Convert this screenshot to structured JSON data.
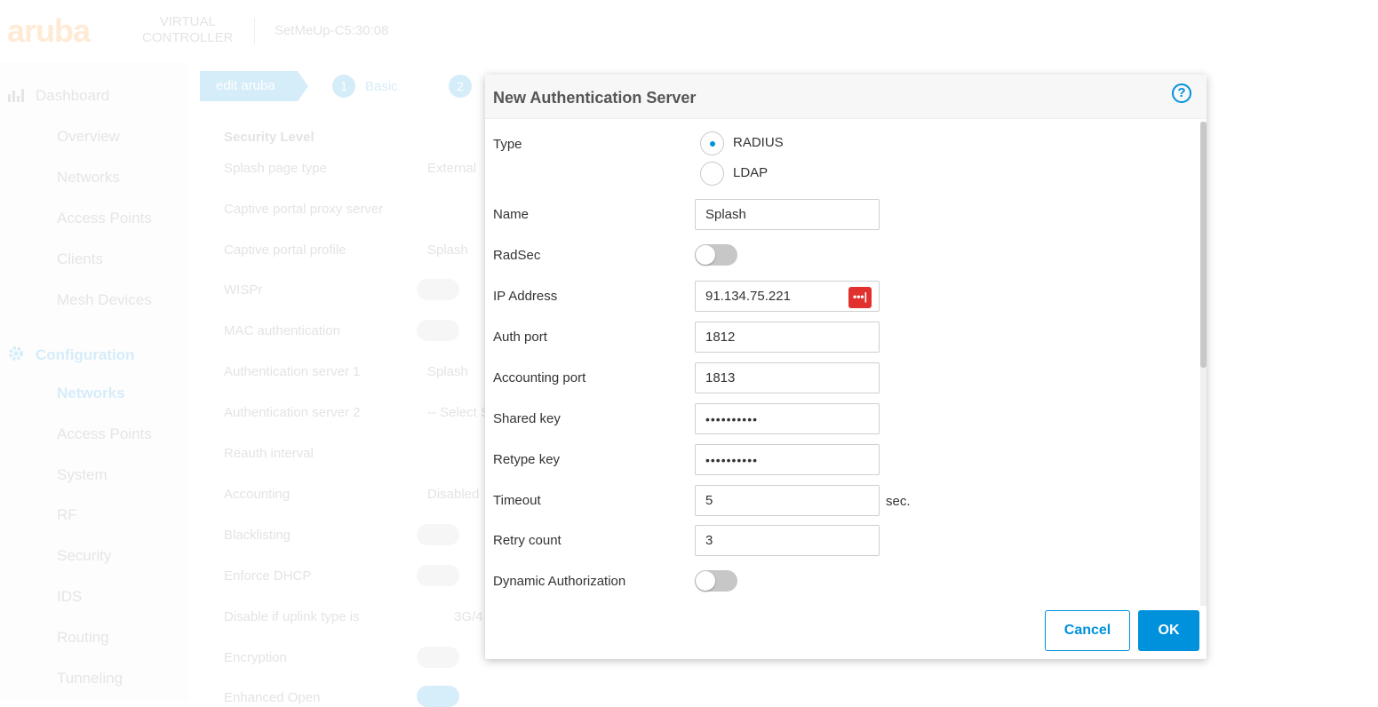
{
  "background": {
    "brand_logo": "aruba",
    "product_line1": "VIRTUAL",
    "product_line2": "CONTROLLER",
    "device_name": "SetMeUp-C5:30:08",
    "sidebar": {
      "dashboard": "Dashboard",
      "dashboard_items": [
        "Overview",
        "Networks",
        "Access Points",
        "Clients",
        "Mesh Devices"
      ],
      "configuration": "Configuration",
      "configuration_items": [
        "Networks",
        "Access Points",
        "System",
        "RF",
        "Security",
        "IDS",
        "Routing",
        "Tunneling"
      ]
    },
    "wizard": {
      "current_step": "edit aruba",
      "step1_num": "1",
      "step1_label": "Basic",
      "step2_num": "2"
    },
    "form": {
      "section_title": "Security Level",
      "rows": [
        {
          "label": "Splash page type",
          "value": "External"
        },
        {
          "label": "Captive portal proxy server",
          "value": ""
        },
        {
          "label": "Captive portal profile",
          "value": "Splash"
        },
        {
          "label": "WISPr",
          "value": ""
        },
        {
          "label": "MAC authentication",
          "value": ""
        },
        {
          "label": "Authentication server 1",
          "value": "Splash"
        },
        {
          "label": "Authentication server 2",
          "value": "-- Select S"
        },
        {
          "label": "Reauth interval",
          "value": ""
        },
        {
          "label": "Accounting",
          "value": "Disabled"
        },
        {
          "label": "Blacklisting",
          "value": ""
        },
        {
          "label": "Enforce DHCP",
          "value": ""
        },
        {
          "label": "Disable if uplink type is",
          "value": "3G/4"
        },
        {
          "label": "Encryption",
          "value": ""
        },
        {
          "label": "Enhanced Open",
          "value": ""
        }
      ]
    }
  },
  "modal": {
    "title": "New Authentication Server",
    "help_icon": "question-circle-icon",
    "type": {
      "label": "Type",
      "options": [
        "RADIUS",
        "LDAP"
      ],
      "selected": "RADIUS"
    },
    "name": {
      "label": "Name",
      "value": "Splash"
    },
    "radsec": {
      "label": "RadSec",
      "enabled": false
    },
    "ip_address": {
      "label": "IP Address",
      "value": "91.134.75.221",
      "password_manager_icon": "password-manager-icon",
      "password_manager_glyph": "•••|"
    },
    "auth_port": {
      "label": "Auth port",
      "value": "1812"
    },
    "accounting_port": {
      "label": "Accounting port",
      "value": "1813"
    },
    "shared_key": {
      "label": "Shared key",
      "value": "••••••••••"
    },
    "retype_key": {
      "label": "Retype key",
      "value": "••••••••••"
    },
    "timeout": {
      "label": "Timeout",
      "value": "5",
      "unit": "sec."
    },
    "retry_count": {
      "label": "Retry count",
      "value": "3"
    },
    "dynamic_authorization": {
      "label": "Dynamic Authorization",
      "enabled": false
    },
    "buttons": {
      "cancel": "Cancel",
      "ok": "OK"
    },
    "accent_color": "#0091dd"
  }
}
